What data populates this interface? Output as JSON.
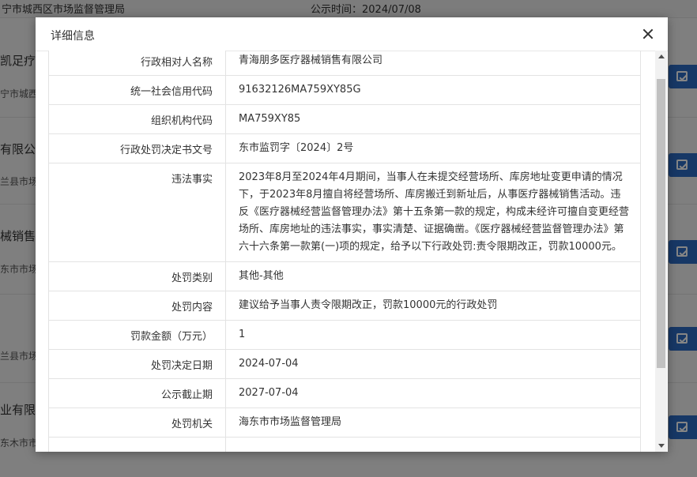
{
  "background": {
    "header_left": "宁市城西区市场监督管理局",
    "header_right": "公示时间：2024/07/08",
    "fragments": [
      "凯足疗",
      "宁市城西",
      "有限公",
      "兰县市场",
      "械销售",
      "东市市场",
      "兰县市场",
      "业有限",
      "东木市市"
    ]
  },
  "modal": {
    "title": "详细信息",
    "rows": [
      {
        "label": "行政相对人名称",
        "value": "青海朋多医疗器械销售有限公司"
      },
      {
        "label": "统一社会信用代码",
        "value": "91632126MA759XY85G"
      },
      {
        "label": "组织机构代码",
        "value": "MA759XY85"
      },
      {
        "label": "行政处罚决定书文号",
        "value": "东市监罚字〔2024〕2号"
      },
      {
        "label": "违法事实",
        "value": "2023年8月至2024年4月期间，当事人在未提交经营场所、库房地址变更申请的情况下，于2023年8月擅自将经营场所、库房搬迁到新址后，从事医疗器械销售活动。违反《医疗器械经营监督管理办法》第十五条第一款的规定，构成未经许可擅自变更经营场所、库房地址的违法事实，事实清楚、证据确凿。《医疗器械经营监督管理办法》第六十六条第一款第(一)项的规定，给予以下行政处罚:责令限期改正，罚款10000元。"
      },
      {
        "label": "处罚类别",
        "value": "其他-其他"
      },
      {
        "label": "处罚内容",
        "value": "建议给予当事人责令限期改正，罚款10000元的行政处罚"
      },
      {
        "label": "罚款金额（万元）",
        "value": "1"
      },
      {
        "label": "处罚决定日期",
        "value": "2024-07-04"
      },
      {
        "label": "公示截止期",
        "value": "2027-07-04"
      },
      {
        "label": "处罚机关",
        "value": "海东市市场监督管理局"
      }
    ]
  },
  "colors": {
    "action_button": "#2c6cc4",
    "overlay": "#000000"
  }
}
